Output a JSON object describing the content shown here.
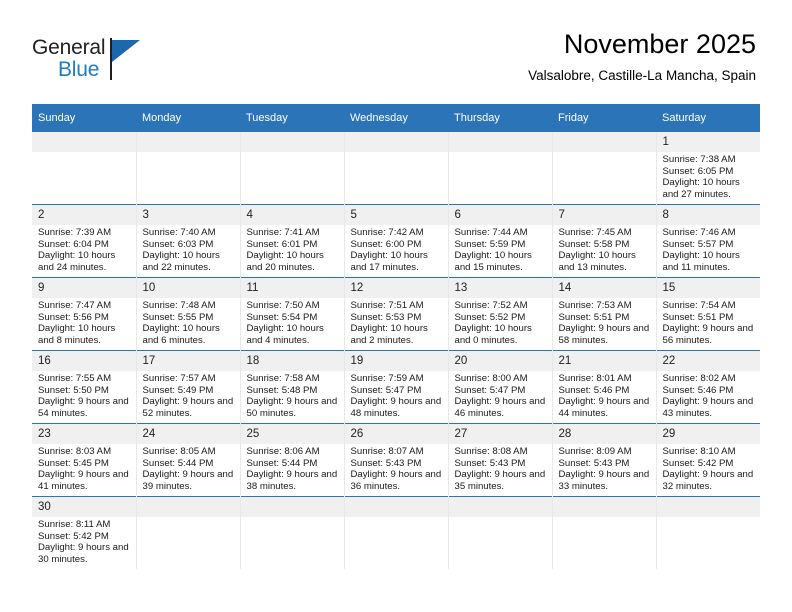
{
  "brand": {
    "name_part1": "General",
    "name_part2": "Blue",
    "flag_icon": "flag-triangle-icon"
  },
  "header": {
    "title": "November 2025",
    "location": "Valsalobre, Castille-La Mancha, Spain"
  },
  "calendar": {
    "weekday_headers": [
      "Sunday",
      "Monday",
      "Tuesday",
      "Wednesday",
      "Thursday",
      "Friday",
      "Saturday"
    ],
    "colors": {
      "header_blue": "#2b74b8",
      "daynum_band": "#f0f0f0",
      "row_separator": "#2b74b8",
      "column_divider": "#e8e8e8",
      "brand_blue": "#1c7cc4"
    },
    "weeks": [
      [
        {
          "day": "",
          "blank": true
        },
        {
          "day": "",
          "blank": true
        },
        {
          "day": "",
          "blank": true
        },
        {
          "day": "",
          "blank": true
        },
        {
          "day": "",
          "blank": true
        },
        {
          "day": "",
          "blank": true
        },
        {
          "day": "1",
          "sunrise": "Sunrise: 7:38 AM",
          "sunset": "Sunset: 6:05 PM",
          "daylight": "Daylight: 10 hours and 27 minutes."
        }
      ],
      [
        {
          "day": "2",
          "sunrise": "Sunrise: 7:39 AM",
          "sunset": "Sunset: 6:04 PM",
          "daylight": "Daylight: 10 hours and 24 minutes."
        },
        {
          "day": "3",
          "sunrise": "Sunrise: 7:40 AM",
          "sunset": "Sunset: 6:03 PM",
          "daylight": "Daylight: 10 hours and 22 minutes."
        },
        {
          "day": "4",
          "sunrise": "Sunrise: 7:41 AM",
          "sunset": "Sunset: 6:01 PM",
          "daylight": "Daylight: 10 hours and 20 minutes."
        },
        {
          "day": "5",
          "sunrise": "Sunrise: 7:42 AM",
          "sunset": "Sunset: 6:00 PM",
          "daylight": "Daylight: 10 hours and 17 minutes."
        },
        {
          "day": "6",
          "sunrise": "Sunrise: 7:44 AM",
          "sunset": "Sunset: 5:59 PM",
          "daylight": "Daylight: 10 hours and 15 minutes."
        },
        {
          "day": "7",
          "sunrise": "Sunrise: 7:45 AM",
          "sunset": "Sunset: 5:58 PM",
          "daylight": "Daylight: 10 hours and 13 minutes."
        },
        {
          "day": "8",
          "sunrise": "Sunrise: 7:46 AM",
          "sunset": "Sunset: 5:57 PM",
          "daylight": "Daylight: 10 hours and 11 minutes."
        }
      ],
      [
        {
          "day": "9",
          "sunrise": "Sunrise: 7:47 AM",
          "sunset": "Sunset: 5:56 PM",
          "daylight": "Daylight: 10 hours and 8 minutes."
        },
        {
          "day": "10",
          "sunrise": "Sunrise: 7:48 AM",
          "sunset": "Sunset: 5:55 PM",
          "daylight": "Daylight: 10 hours and 6 minutes."
        },
        {
          "day": "11",
          "sunrise": "Sunrise: 7:50 AM",
          "sunset": "Sunset: 5:54 PM",
          "daylight": "Daylight: 10 hours and 4 minutes."
        },
        {
          "day": "12",
          "sunrise": "Sunrise: 7:51 AM",
          "sunset": "Sunset: 5:53 PM",
          "daylight": "Daylight: 10 hours and 2 minutes."
        },
        {
          "day": "13",
          "sunrise": "Sunrise: 7:52 AM",
          "sunset": "Sunset: 5:52 PM",
          "daylight": "Daylight: 10 hours and 0 minutes."
        },
        {
          "day": "14",
          "sunrise": "Sunrise: 7:53 AM",
          "sunset": "Sunset: 5:51 PM",
          "daylight": "Daylight: 9 hours and 58 minutes."
        },
        {
          "day": "15",
          "sunrise": "Sunrise: 7:54 AM",
          "sunset": "Sunset: 5:51 PM",
          "daylight": "Daylight: 9 hours and 56 minutes."
        }
      ],
      [
        {
          "day": "16",
          "sunrise": "Sunrise: 7:55 AM",
          "sunset": "Sunset: 5:50 PM",
          "daylight": "Daylight: 9 hours and 54 minutes."
        },
        {
          "day": "17",
          "sunrise": "Sunrise: 7:57 AM",
          "sunset": "Sunset: 5:49 PM",
          "daylight": "Daylight: 9 hours and 52 minutes."
        },
        {
          "day": "18",
          "sunrise": "Sunrise: 7:58 AM",
          "sunset": "Sunset: 5:48 PM",
          "daylight": "Daylight: 9 hours and 50 minutes."
        },
        {
          "day": "19",
          "sunrise": "Sunrise: 7:59 AM",
          "sunset": "Sunset: 5:47 PM",
          "daylight": "Daylight: 9 hours and 48 minutes."
        },
        {
          "day": "20",
          "sunrise": "Sunrise: 8:00 AM",
          "sunset": "Sunset: 5:47 PM",
          "daylight": "Daylight: 9 hours and 46 minutes."
        },
        {
          "day": "21",
          "sunrise": "Sunrise: 8:01 AM",
          "sunset": "Sunset: 5:46 PM",
          "daylight": "Daylight: 9 hours and 44 minutes."
        },
        {
          "day": "22",
          "sunrise": "Sunrise: 8:02 AM",
          "sunset": "Sunset: 5:46 PM",
          "daylight": "Daylight: 9 hours and 43 minutes."
        }
      ],
      [
        {
          "day": "23",
          "sunrise": "Sunrise: 8:03 AM",
          "sunset": "Sunset: 5:45 PM",
          "daylight": "Daylight: 9 hours and 41 minutes."
        },
        {
          "day": "24",
          "sunrise": "Sunrise: 8:05 AM",
          "sunset": "Sunset: 5:44 PM",
          "daylight": "Daylight: 9 hours and 39 minutes."
        },
        {
          "day": "25",
          "sunrise": "Sunrise: 8:06 AM",
          "sunset": "Sunset: 5:44 PM",
          "daylight": "Daylight: 9 hours and 38 minutes."
        },
        {
          "day": "26",
          "sunrise": "Sunrise: 8:07 AM",
          "sunset": "Sunset: 5:43 PM",
          "daylight": "Daylight: 9 hours and 36 minutes."
        },
        {
          "day": "27",
          "sunrise": "Sunrise: 8:08 AM",
          "sunset": "Sunset: 5:43 PM",
          "daylight": "Daylight: 9 hours and 35 minutes."
        },
        {
          "day": "28",
          "sunrise": "Sunrise: 8:09 AM",
          "sunset": "Sunset: 5:43 PM",
          "daylight": "Daylight: 9 hours and 33 minutes."
        },
        {
          "day": "29",
          "sunrise": "Sunrise: 8:10 AM",
          "sunset": "Sunset: 5:42 PM",
          "daylight": "Daylight: 9 hours and 32 minutes."
        }
      ],
      [
        {
          "day": "30",
          "sunrise": "Sunrise: 8:11 AM",
          "sunset": "Sunset: 5:42 PM",
          "daylight": "Daylight: 9 hours and 30 minutes."
        },
        {
          "day": "",
          "blank": true
        },
        {
          "day": "",
          "blank": true
        },
        {
          "day": "",
          "blank": true
        },
        {
          "day": "",
          "blank": true
        },
        {
          "day": "",
          "blank": true
        },
        {
          "day": "",
          "blank": true
        }
      ]
    ]
  }
}
